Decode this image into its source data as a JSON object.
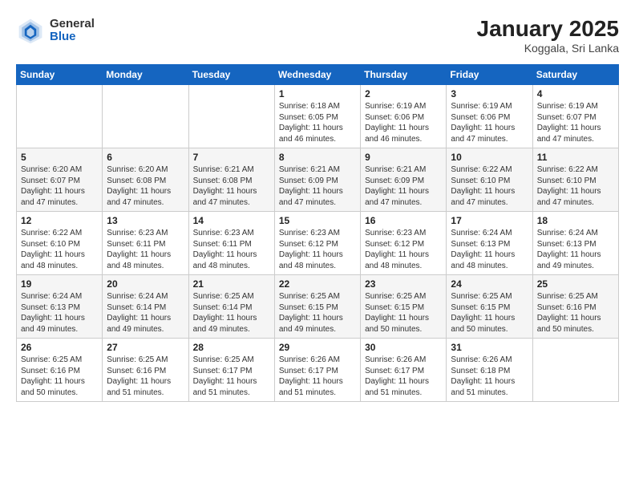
{
  "logo": {
    "general": "General",
    "blue": "Blue"
  },
  "title": "January 2025",
  "subtitle": "Koggala, Sri Lanka",
  "weekdays": [
    "Sunday",
    "Monday",
    "Tuesday",
    "Wednesday",
    "Thursday",
    "Friday",
    "Saturday"
  ],
  "weeks": [
    [
      {
        "day": "",
        "info": ""
      },
      {
        "day": "",
        "info": ""
      },
      {
        "day": "",
        "info": ""
      },
      {
        "day": "1",
        "info": "Sunrise: 6:18 AM\nSunset: 6:05 PM\nDaylight: 11 hours\nand 46 minutes."
      },
      {
        "day": "2",
        "info": "Sunrise: 6:19 AM\nSunset: 6:06 PM\nDaylight: 11 hours\nand 46 minutes."
      },
      {
        "day": "3",
        "info": "Sunrise: 6:19 AM\nSunset: 6:06 PM\nDaylight: 11 hours\nand 47 minutes."
      },
      {
        "day": "4",
        "info": "Sunrise: 6:19 AM\nSunset: 6:07 PM\nDaylight: 11 hours\nand 47 minutes."
      }
    ],
    [
      {
        "day": "5",
        "info": "Sunrise: 6:20 AM\nSunset: 6:07 PM\nDaylight: 11 hours\nand 47 minutes."
      },
      {
        "day": "6",
        "info": "Sunrise: 6:20 AM\nSunset: 6:08 PM\nDaylight: 11 hours\nand 47 minutes."
      },
      {
        "day": "7",
        "info": "Sunrise: 6:21 AM\nSunset: 6:08 PM\nDaylight: 11 hours\nand 47 minutes."
      },
      {
        "day": "8",
        "info": "Sunrise: 6:21 AM\nSunset: 6:09 PM\nDaylight: 11 hours\nand 47 minutes."
      },
      {
        "day": "9",
        "info": "Sunrise: 6:21 AM\nSunset: 6:09 PM\nDaylight: 11 hours\nand 47 minutes."
      },
      {
        "day": "10",
        "info": "Sunrise: 6:22 AM\nSunset: 6:10 PM\nDaylight: 11 hours\nand 47 minutes."
      },
      {
        "day": "11",
        "info": "Sunrise: 6:22 AM\nSunset: 6:10 PM\nDaylight: 11 hours\nand 47 minutes."
      }
    ],
    [
      {
        "day": "12",
        "info": "Sunrise: 6:22 AM\nSunset: 6:10 PM\nDaylight: 11 hours\nand 48 minutes."
      },
      {
        "day": "13",
        "info": "Sunrise: 6:23 AM\nSunset: 6:11 PM\nDaylight: 11 hours\nand 48 minutes."
      },
      {
        "day": "14",
        "info": "Sunrise: 6:23 AM\nSunset: 6:11 PM\nDaylight: 11 hours\nand 48 minutes."
      },
      {
        "day": "15",
        "info": "Sunrise: 6:23 AM\nSunset: 6:12 PM\nDaylight: 11 hours\nand 48 minutes."
      },
      {
        "day": "16",
        "info": "Sunrise: 6:23 AM\nSunset: 6:12 PM\nDaylight: 11 hours\nand 48 minutes."
      },
      {
        "day": "17",
        "info": "Sunrise: 6:24 AM\nSunset: 6:13 PM\nDaylight: 11 hours\nand 48 minutes."
      },
      {
        "day": "18",
        "info": "Sunrise: 6:24 AM\nSunset: 6:13 PM\nDaylight: 11 hours\nand 49 minutes."
      }
    ],
    [
      {
        "day": "19",
        "info": "Sunrise: 6:24 AM\nSunset: 6:13 PM\nDaylight: 11 hours\nand 49 minutes."
      },
      {
        "day": "20",
        "info": "Sunrise: 6:24 AM\nSunset: 6:14 PM\nDaylight: 11 hours\nand 49 minutes."
      },
      {
        "day": "21",
        "info": "Sunrise: 6:25 AM\nSunset: 6:14 PM\nDaylight: 11 hours\nand 49 minutes."
      },
      {
        "day": "22",
        "info": "Sunrise: 6:25 AM\nSunset: 6:15 PM\nDaylight: 11 hours\nand 49 minutes."
      },
      {
        "day": "23",
        "info": "Sunrise: 6:25 AM\nSunset: 6:15 PM\nDaylight: 11 hours\nand 50 minutes."
      },
      {
        "day": "24",
        "info": "Sunrise: 6:25 AM\nSunset: 6:15 PM\nDaylight: 11 hours\nand 50 minutes."
      },
      {
        "day": "25",
        "info": "Sunrise: 6:25 AM\nSunset: 6:16 PM\nDaylight: 11 hours\nand 50 minutes."
      }
    ],
    [
      {
        "day": "26",
        "info": "Sunrise: 6:25 AM\nSunset: 6:16 PM\nDaylight: 11 hours\nand 50 minutes."
      },
      {
        "day": "27",
        "info": "Sunrise: 6:25 AM\nSunset: 6:16 PM\nDaylight: 11 hours\nand 51 minutes."
      },
      {
        "day": "28",
        "info": "Sunrise: 6:25 AM\nSunset: 6:17 PM\nDaylight: 11 hours\nand 51 minutes."
      },
      {
        "day": "29",
        "info": "Sunrise: 6:26 AM\nSunset: 6:17 PM\nDaylight: 11 hours\nand 51 minutes."
      },
      {
        "day": "30",
        "info": "Sunrise: 6:26 AM\nSunset: 6:17 PM\nDaylight: 11 hours\nand 51 minutes."
      },
      {
        "day": "31",
        "info": "Sunrise: 6:26 AM\nSunset: 6:18 PM\nDaylight: 11 hours\nand 51 minutes."
      },
      {
        "day": "",
        "info": ""
      }
    ]
  ]
}
